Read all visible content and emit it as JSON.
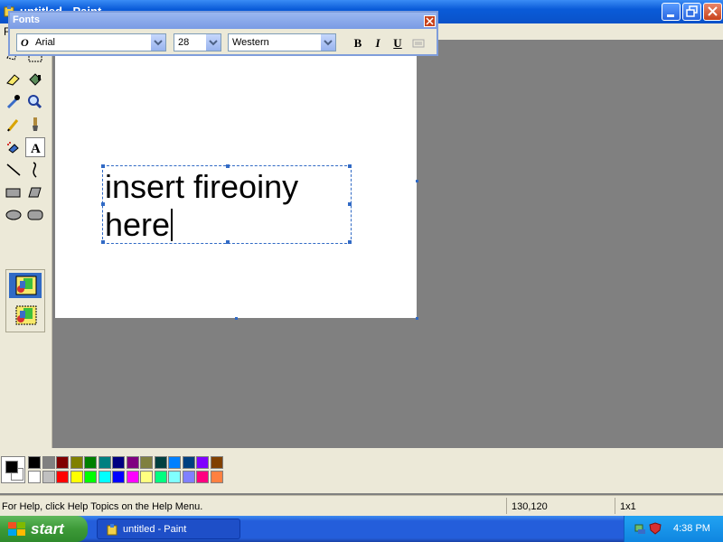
{
  "window": {
    "title": "untitled - Paint",
    "menu_first": "F"
  },
  "fonts_toolbar": {
    "title": "Fonts",
    "font_name": "Arial",
    "font_size": "28",
    "script": "Western",
    "bold": "B",
    "italic": "I",
    "underline": "U"
  },
  "canvas": {
    "text_line1": "insert fireoiny",
    "text_line2": "here"
  },
  "palette": {
    "top_row": [
      "#000000",
      "#808080",
      "#800000",
      "#808000",
      "#008000",
      "#008080",
      "#000080",
      "#800080",
      "#808040",
      "#004040",
      "#0080ff",
      "#004080",
      "#8000ff",
      "#804000"
    ],
    "bottom_row": [
      "#ffffff",
      "#c0c0c0",
      "#ff0000",
      "#ffff00",
      "#00ff00",
      "#00ffff",
      "#0000ff",
      "#ff00ff",
      "#ffff80",
      "#00ff80",
      "#80ffff",
      "#8080ff",
      "#ff0080",
      "#ff8040"
    ]
  },
  "status": {
    "help_text": "For Help, click Help Topics on the Help Menu.",
    "coords": "130,120",
    "size": "1x1"
  },
  "taskbar": {
    "start_label": "start",
    "task_label": "untitled - Paint",
    "clock": "4:38 PM"
  }
}
